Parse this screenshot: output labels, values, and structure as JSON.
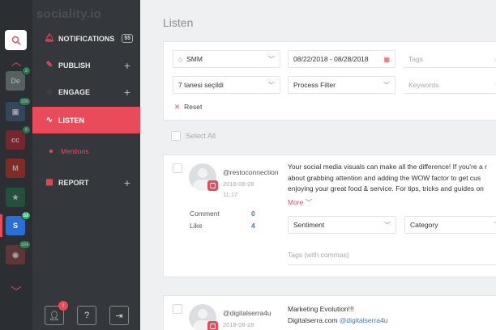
{
  "app": {
    "brand": "sociality.io"
  },
  "rail": {
    "accounts": [
      {
        "icon": "de-account-icon",
        "label": "De",
        "color": "#7b8a84",
        "badge": "2"
      },
      {
        "icon": "photo-account-icon",
        "label": "▣",
        "color": "#3a5a7a",
        "badge": "100"
      },
      {
        "icon": "cocacola-account-icon",
        "label": "cc",
        "color": "#b8202a",
        "badge": "5"
      },
      {
        "icon": "mcdonalds-account-icon",
        "label": "M",
        "color": "#c8281c",
        "badge": ""
      },
      {
        "icon": "starbucks-account-icon",
        "label": "★",
        "color": "#1b6b45",
        "badge": ""
      },
      {
        "icon": "sociality-account-icon",
        "label": "S",
        "color": "#2a6fd6",
        "badge": "53"
      },
      {
        "icon": "lock-account-icon",
        "label": "◉",
        "color": "#8b3a3a",
        "badge": "104"
      }
    ]
  },
  "nav": {
    "notifications": {
      "label": "NOTIFICATIONS",
      "count": "55"
    },
    "publish": {
      "label": "PUBLISH"
    },
    "engage": {
      "label": "ENGAGE"
    },
    "listen": {
      "label": "LISTEN"
    },
    "mentions": {
      "label": "Mentions"
    },
    "report": {
      "label": "REPORT"
    }
  },
  "footer": {
    "notification_badge": "!",
    "help": "?"
  },
  "page": {
    "title": "Listen"
  },
  "filters": {
    "source": "SMM",
    "date_range": "08/22/2018 - 08/28/2018",
    "tags_placeholder": "Tags",
    "selected_count": "7 tanesi seçildi",
    "process_filter": "Process Filter",
    "keywords_placeholder": "Keywords",
    "reset": "Reset",
    "select_all": "Select All"
  },
  "posts": [
    {
      "username": "@restoconnection",
      "date": "2018-08-28",
      "time": "11:17",
      "comment_label": "Comment",
      "comment_value": "0",
      "like_label": "Like",
      "like_value": "4",
      "text_lines": [
        "Your social media visuals can make all the difference! If you're a r",
        "about grabbing attention and adding the WOW factor to get cus",
        "enjoying your great food & service. For tips, tricks and guides on"
      ],
      "more": "More",
      "sentiment": "Sentiment",
      "category": "Category",
      "tags_placeholder": "Tags (with commas)"
    },
    {
      "username": "@digitalserra4u",
      "date": "2018-08-28",
      "text_line1": "Marketing Evolution!!!",
      "text_line2_prefix": "Digitalserra.com ",
      "text_line2_link": "@digitalserra4u"
    }
  ],
  "colors": {
    "accent": "#e94b5a",
    "sidebar": "#34383c",
    "rail": "#2b2f33",
    "link": "#3e78c8"
  }
}
